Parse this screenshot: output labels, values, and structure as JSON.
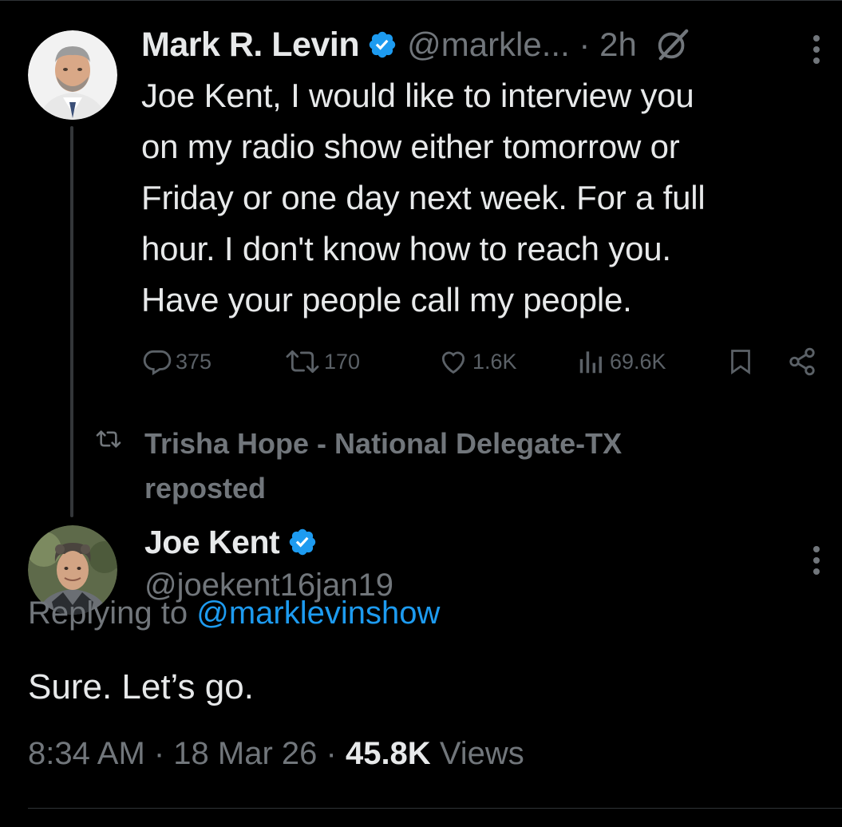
{
  "colors": {
    "background": "#000000",
    "text_primary": "#e7e9ea",
    "text_secondary": "#71767b",
    "accent_link": "#1d9bf0",
    "verified_badge": "#1d9bf0",
    "divider": "#2f3336"
  },
  "original_post": {
    "author_name": "Mark R. Levin",
    "handle_time": "@markle... · 2h",
    "verified_icon": "verified-badge-icon",
    "grok_icon": "grok-icon",
    "more_icon": "more-options-icon",
    "text": "Joe Kent, I would like to interview you\non my radio show either tomorrow or\nFriday or one day next week.  For a full\nhour.  I don't know how to reach you.\nHave your people call my people.",
    "actions": {
      "replies": "375",
      "reposts": "170",
      "likes": "1.6K",
      "views": "69.6K"
    }
  },
  "repost_notice": {
    "text": "Trisha Hope - National Delegate-TX reposted",
    "icon": "repost-icon"
  },
  "reply_post": {
    "author_name": "Joe Kent",
    "handle": "@joekent16jan19",
    "replying_prefix": "Replying to ",
    "replying_to": "@marklevinshow",
    "text": "Sure. Let’s go.",
    "timestamp": "8:34 AM · 18 Mar 26 · ",
    "views_count": "45.8K",
    "views_label": " Views",
    "more_icon": "more-options-icon"
  }
}
